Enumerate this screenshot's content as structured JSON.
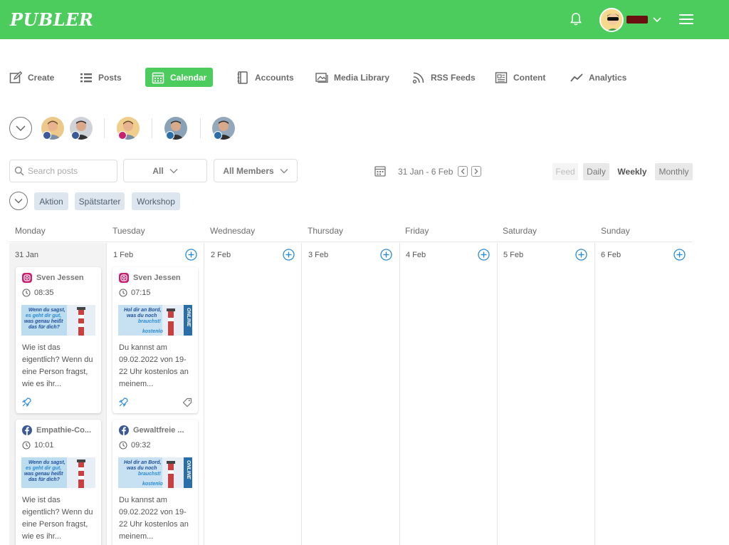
{
  "app": {
    "logo": "PUBLER"
  },
  "colors": {
    "brand": "#4bcc5c",
    "accent_blue": "#2a8bd6",
    "instagram": "#c9206f",
    "facebook": "#3b5998"
  },
  "topbar": {
    "icons": [
      "bell-icon",
      "avatar",
      "chevron-down-icon",
      "hamburger-icon"
    ]
  },
  "nav": {
    "items": [
      {
        "label": "Create",
        "icon": "edit-icon"
      },
      {
        "label": "Posts",
        "icon": "list-icon"
      },
      {
        "label": "Calendar",
        "icon": "calendar-icon",
        "active": true
      },
      {
        "label": "Accounts",
        "icon": "book-icon"
      },
      {
        "label": "Media Library",
        "icon": "image-icon"
      },
      {
        "label": "RSS Feeds",
        "icon": "rss-icon"
      },
      {
        "label": "Content",
        "icon": "newspaper-icon"
      },
      {
        "label": "Analytics",
        "icon": "trend-icon"
      }
    ]
  },
  "filters": {
    "search_placeholder": "Search posts",
    "type_filter": "All",
    "members_filter": "All Members",
    "date_range": "31 Jan - 6 Feb",
    "views": [
      {
        "label": "Feed",
        "state": "disabled"
      },
      {
        "label": "Daily",
        "state": "normal"
      },
      {
        "label": "Weekly",
        "state": "active"
      },
      {
        "label": "Monthly",
        "state": "normal"
      }
    ]
  },
  "tags": [
    "Aktion",
    "Spätstarter",
    "Workshop"
  ],
  "calendar": {
    "day_names": [
      "Monday",
      "Tuesday",
      "Wednesday",
      "Thursday",
      "Friday",
      "Saturday",
      "Sunday"
    ],
    "dates": [
      "31 Jan",
      "1 Feb",
      "2 Feb",
      "3 Feb",
      "4 Feb",
      "5 Feb",
      "6 Feb"
    ]
  },
  "posts": {
    "mon1": {
      "author": "Sven Jessen",
      "network": "instagram",
      "time": "08:35",
      "image_lines": [
        "Wenn du sagst,",
        "es geht dir gut,",
        "was genau heißt",
        "das für dich?"
      ],
      "text": "Wie ist das eigentlich? Wenn du eine Person fragst, wie es ihr..."
    },
    "tue1": {
      "author": "Sven Jessen",
      "network": "instagram",
      "time": "07:15",
      "image_lines": [
        "Hol dir an Bord,",
        "was du noch",
        "brauchst!",
        "kostenlo",
        "ONLINE"
      ],
      "text": "Du kannst am 09.02.2022 von 19-22 Uhr kostenlos an meinem..."
    },
    "mon2": {
      "author": "Empathie-Co...",
      "network": "facebook",
      "time": "10:01",
      "image_lines": [
        "Wenn du sagst,",
        "es geht dir gut,",
        "was genau heißt",
        "das für dich?"
      ],
      "text": "Wie ist das eigentlich? Wenn du eine Person fragst, wie es ihr..."
    },
    "tue2": {
      "author": "Gewaltfreie ...",
      "network": "facebook",
      "time": "09:32",
      "image_lines": [
        "Hol dir an Bord,",
        "was du noch",
        "brauchst!",
        "kostenlo",
        "ONLINE"
      ],
      "text": "Du kannst am 09.02.2022 von 19-22 Uhr kostenlos an meinem..."
    }
  }
}
